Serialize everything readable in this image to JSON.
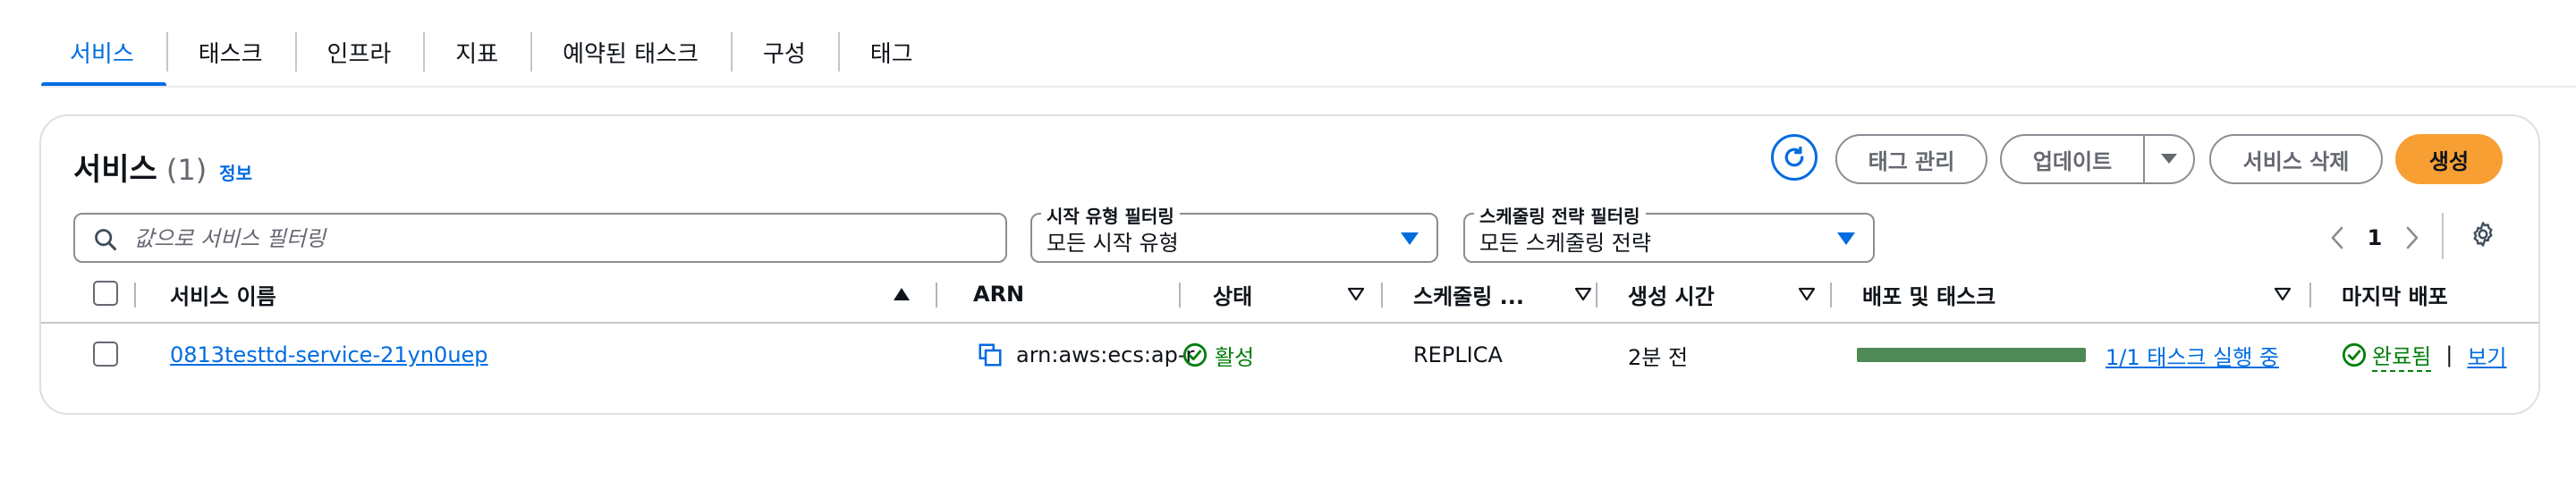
{
  "tabs": [
    "서비스",
    "태스크",
    "인프라",
    "지표",
    "예약된 태스크",
    "구성",
    "태그"
  ],
  "panel": {
    "title": "서비스",
    "count": "(1)",
    "info": "정보"
  },
  "actions": {
    "refresh_icon": "refresh-icon",
    "manage_tags": "태그 관리",
    "update": "업데이트",
    "delete_service": "서비스 삭제",
    "create": "생성"
  },
  "search": {
    "placeholder": "값으로 서비스 필터링",
    "value": ""
  },
  "filters": {
    "launch_type": {
      "label": "시작 유형 필터링",
      "value": "모든 시작 유형"
    },
    "scheduling": {
      "label": "스케줄링 전략 필터링",
      "value": "모든 스케줄링 전략"
    }
  },
  "pagination": {
    "current_page": "1"
  },
  "table": {
    "headers": {
      "name": "서비스 이름",
      "arn": "ARN",
      "status": "상태",
      "scheduling": "스케줄링 ...",
      "created": "생성 시간",
      "deployment": "배포 및 태스크",
      "last_deployment": "마지막 배포"
    },
    "rows": [
      {
        "name": "0813testtd-service-21yn0uep",
        "arn": "arn:aws:ecs:ap-r",
        "status": "활성",
        "scheduling": "REPLICA",
        "created": "2분 전",
        "tasks_progress": 1.0,
        "tasks_text": "1/1 태스크 실행 중",
        "last_deployment_status": "완료됨",
        "separator": "|",
        "view": "보기"
      }
    ]
  },
  "colors": {
    "accent": "#006ce0",
    "primary_button": "#f89f34",
    "success": "#037f0c",
    "progress": "#4e8a55"
  }
}
